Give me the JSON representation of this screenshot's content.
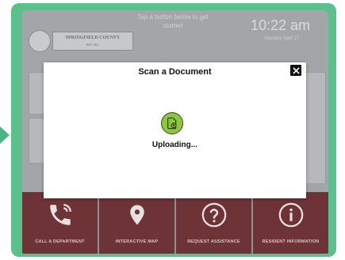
{
  "header": {
    "county_name": "SPRINGFIELD COUNTY",
    "county_est": "EST. 1821",
    "hint": "Tap a button below to get started",
    "time": "10:22 am",
    "date": "Monday April 17"
  },
  "modal": {
    "title": "Scan a Document",
    "status": "Uploading..."
  },
  "tiles": [
    {
      "label": "CALL A DEPARTMENT",
      "icon": "phone-icon"
    },
    {
      "label": "INTERACTIVE MAP",
      "icon": "map-pin-icon"
    },
    {
      "label": "REQUEST ASSISTANCE",
      "icon": "question-icon"
    },
    {
      "label": "RESIDENT INFORMATION",
      "icon": "info-icon"
    }
  ],
  "colors": {
    "frame": "#5cc08c",
    "tile": "#6e3336",
    "status_icon": "#8dc63f"
  }
}
